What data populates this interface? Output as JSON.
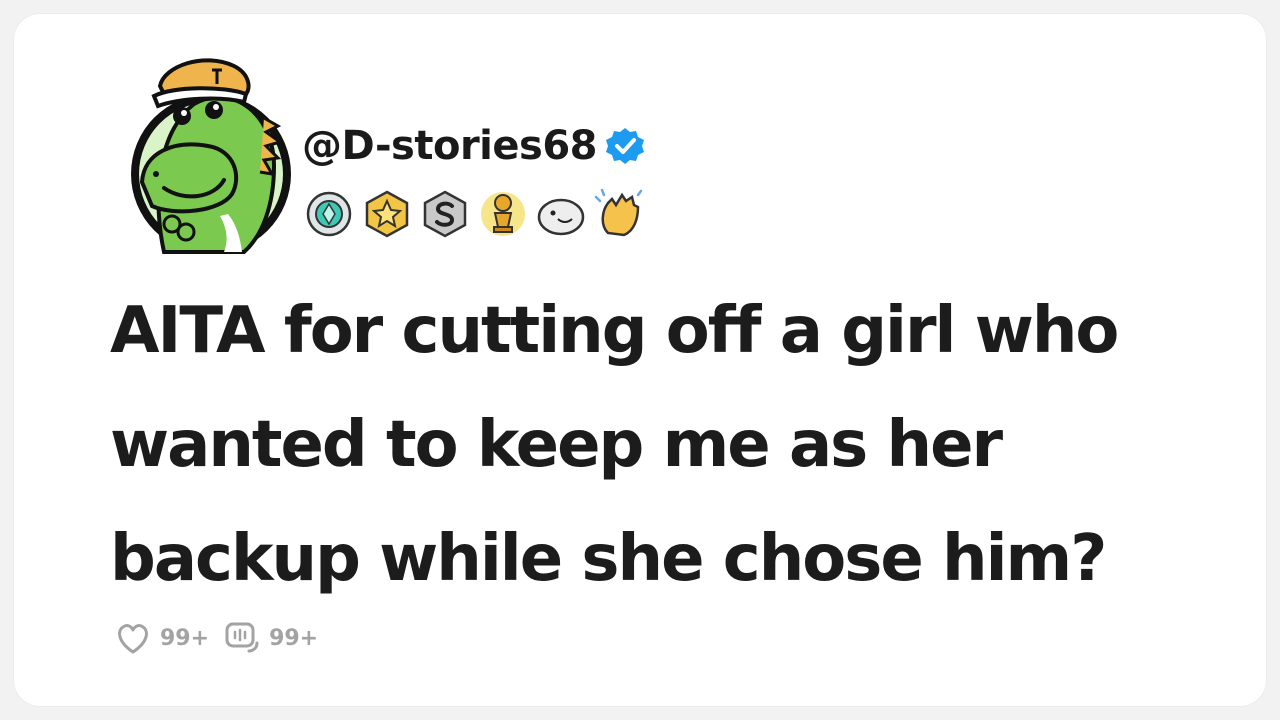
{
  "post": {
    "username": "@D-stories68",
    "title": "AITA for cutting off a girl who wanted to keep me as her backup while she chose him?",
    "likes": "99+",
    "comments": "99+"
  },
  "colors": {
    "verified": "#1d9bf0",
    "text": "#1c1c1c",
    "muted": "#a3a3a3",
    "avatar_ring": "#d8f4c8",
    "dino_green": "#7cc950"
  },
  "badges": [
    "diamond-badge",
    "star-badge",
    "s-badge",
    "trophy-badge",
    "seal-badge",
    "clap-badge"
  ]
}
